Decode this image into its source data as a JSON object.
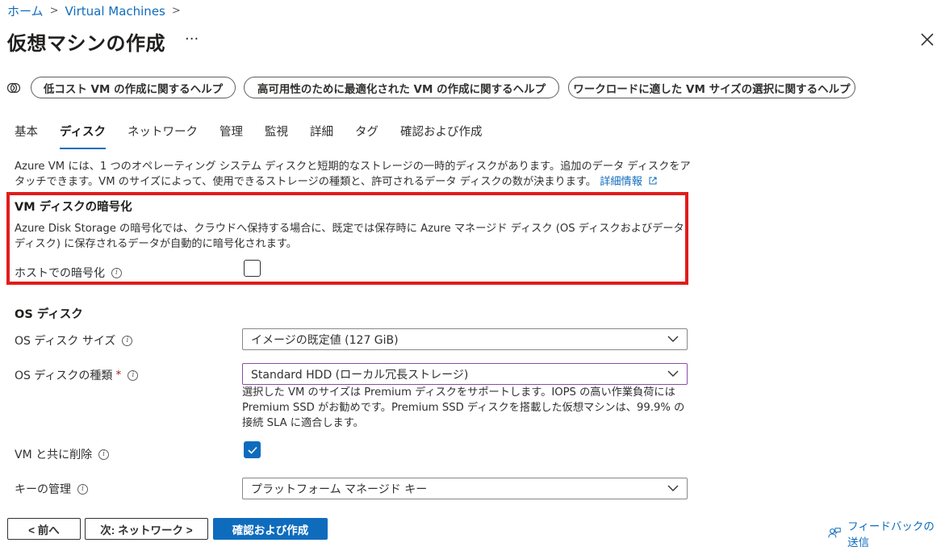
{
  "breadcrumb": {
    "home": "ホーム",
    "sep": ">",
    "current": "Virtual Machines",
    "sep2": ">"
  },
  "header": {
    "title": "仮想マシンの作成",
    "more": "···"
  },
  "help_buttons": [
    "低コスト VM の作成に関するヘルプ",
    "高可用性のために最適化された VM の作成に関するヘルプ",
    "ワークロードに適した VM サイズの選択に関するヘルプ"
  ],
  "tabs": [
    "基本",
    "ディスク",
    "ネットワーク",
    "管理",
    "監視",
    "詳細",
    "タグ",
    "確認および作成"
  ],
  "active_tab_index": 1,
  "intro": {
    "text": "Azure VM には、1 つのオペレーティング システム ディスクと短期的なストレージの一時的ディスクがあります。追加のデータ ディスクをアタッチできます。VM のサイズによって、使用できるストレージの種類と、許可されるデータ ディスクの数が決まります。",
    "link": "詳細情報"
  },
  "encryption": {
    "title": "VM ディスクの暗号化",
    "description": "Azure Disk Storage の暗号化では、クラウドへ保持する場合に、既定では保存時に Azure マネージド ディスク (OS ディスクおよびデータ ディスク) に保存されるデータが自動的に暗号化されます。",
    "host_label": "ホストでの暗号化",
    "host_checked": false
  },
  "os_disk": {
    "heading": "OS ディスク",
    "size_label": "OS ディスク サイズ",
    "size_value": "イメージの既定値 (127 GiB)",
    "type_label": "OS ディスクの種類",
    "required_mark": "*",
    "type_value": "Standard HDD (ローカル冗長ストレージ)",
    "note": "選択した VM のサイズは Premium ディスクをサポートします。IOPS の高い作業負荷には Premium SSD がお勧めです。Premium SSD ディスクを搭載した仮想マシンは、99.9% の接続 SLA に適合します。",
    "delete_label": "VM と共に削除",
    "delete_checked": true,
    "key_label": "キーの管理",
    "key_value": "プラットフォーム マネージド キー"
  },
  "footer": {
    "prev": "< 前へ",
    "next": "次: ネットワーク >",
    "review": "確認および作成",
    "feedback": "フィードバックの送信"
  },
  "colors": {
    "accent": "#0f6cbd",
    "highlight": "#e11c1c",
    "required": "#a4262c"
  },
  "icons": [
    "chevron-right-icon",
    "more-icon",
    "close-icon",
    "help-icon",
    "info-icon",
    "external-link-icon",
    "chevron-down-icon",
    "checkmark-icon",
    "feedback-icon"
  ]
}
